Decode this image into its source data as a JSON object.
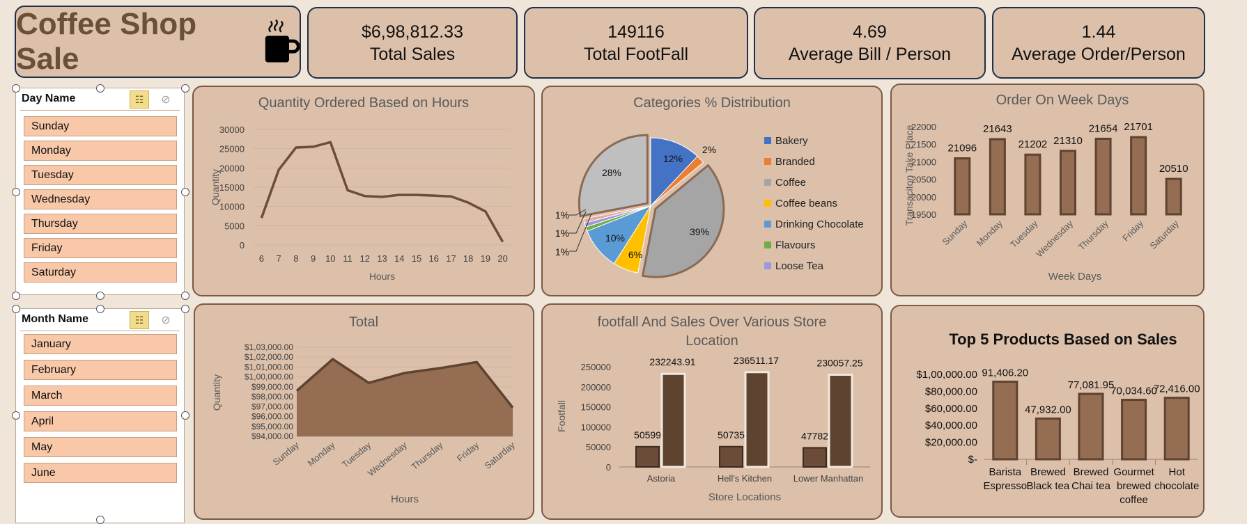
{
  "header": {
    "title": "Coffee Shop Sale"
  },
  "kpis": [
    {
      "value": "$6,98,812.33",
      "label": "Total Sales"
    },
    {
      "value": "149116",
      "label": "Total FootFall"
    },
    {
      "value": "4.69",
      "label": "Average Bill / Person"
    },
    {
      "value": "1.44",
      "label": "Average Order/Person"
    }
  ],
  "slicers": {
    "day": {
      "title": "Day Name",
      "items": [
        "Sunday",
        "Monday",
        "Tuesday",
        "Wednesday",
        "Thursday",
        "Friday",
        "Saturday"
      ]
    },
    "month": {
      "title": "Month Name",
      "items": [
        "January",
        "February",
        "March",
        "April",
        "May",
        "June"
      ]
    }
  },
  "colors": {
    "brown": "#946d52",
    "dark": "#5e4331",
    "line": "#6b4e3a",
    "panel": "#dcc0aa",
    "bakery": "#4472c4",
    "branded": "#ed7d31",
    "coffee": "#a5a5a5",
    "coffee_beans": "#ffc000",
    "drinking_chocolate": "#5b9bd5",
    "flavours": "#70ad47",
    "loose_tea": "#9999dd"
  },
  "chart_data": [
    {
      "type": "line",
      "title": "Quantity Ordered Based on Hours",
      "xlabel": "Hours",
      "ylabel": "Quantity",
      "x": [
        6,
        7,
        8,
        9,
        10,
        11,
        12,
        13,
        14,
        15,
        16,
        17,
        18,
        19,
        20
      ],
      "values": [
        7000,
        19500,
        25300,
        25500,
        26700,
        14200,
        12700,
        12500,
        13000,
        13000,
        12800,
        12600,
        11000,
        8700,
        800
      ],
      "ylim": [
        0,
        30000
      ],
      "yticks": [
        "0",
        "5000",
        "10000",
        "15000",
        "20000",
        "25000",
        "30000"
      ],
      "grid": true
    },
    {
      "type": "pie",
      "title": "Categories % Distribution",
      "slices": [
        {
          "name": "Bakery",
          "value": 12,
          "label": "12%"
        },
        {
          "name": "Branded",
          "value": 2,
          "label": "2%"
        },
        {
          "name": "Coffee",
          "value": 39,
          "label": "39%"
        },
        {
          "name": "Coffee beans",
          "value": 6,
          "label": "6%"
        },
        {
          "name": "Drinking Chocolate",
          "value": 10,
          "label": "10%"
        },
        {
          "name": "Flavours",
          "value": 1,
          "label": "1%"
        },
        {
          "name": "Loose Tea",
          "value": 1,
          "label": "1%"
        },
        {
          "name": "",
          "value": 1,
          "label": "1%"
        },
        {
          "name": "",
          "value": 28,
          "label": "28%"
        }
      ],
      "legend": "right"
    },
    {
      "type": "bar",
      "title": "Order On Week Days",
      "xlabel": "Week Days",
      "ylabel": "Transaciton Take Place",
      "categories": [
        "Sunday",
        "Monday",
        "Tuesday",
        "Wednesday",
        "Thursday",
        "Friday",
        "Saturday"
      ],
      "values": [
        21096,
        21643,
        21202,
        21310,
        21654,
        21701,
        20510
      ],
      "ylim": [
        19500,
        22000
      ],
      "yticks": [
        "19500",
        "20000",
        "20500",
        "21000",
        "21500",
        "22000"
      ]
    },
    {
      "type": "area",
      "title": "Total",
      "xlabel": "Hours",
      "ylabel": "Quantity",
      "categories": [
        "Sunday",
        "Monday",
        "Tuesday",
        "Wednesday",
        "Thursday",
        "Friday",
        "Saturday"
      ],
      "values": [
        98600,
        101800,
        99400,
        100400,
        100900,
        101500,
        96900
      ],
      "ylim": [
        94000,
        103000
      ],
      "yticks": [
        "$94,000.00",
        "$95,000.00",
        "$96,000.00",
        "$97,000.00",
        "$98,000.00",
        "$99,000.00",
        "$1,00,000.00",
        "$1,01,000.00",
        "$1,02,000.00",
        "$1,03,000.00"
      ],
      "grid": true
    },
    {
      "type": "bar",
      "title": "footfall And Sales Over Various Store Location",
      "xlabel": "Store Locations",
      "ylabel": "Footfall",
      "categories": [
        "Astoria",
        "Hell's Kitchen",
        "Lower Manhattan"
      ],
      "series": [
        {
          "values": [
            50599,
            50735,
            47782
          ],
          "labels": [
            "50599",
            "50735",
            "47782"
          ]
        },
        {
          "values": [
            232243.91,
            236511.17,
            230057.25
          ],
          "labels": [
            "232243.91",
            "236511.17",
            "230057.25"
          ]
        }
      ],
      "ylim": [
        0,
        250000
      ],
      "yticks": [
        "0",
        "50000",
        "100000",
        "150000",
        "200000",
        "250000"
      ]
    },
    {
      "type": "bar",
      "title": "Top 5 Products Based on Sales",
      "categories": [
        [
          "Barista",
          "Espresso"
        ],
        [
          "Brewed",
          "Black tea"
        ],
        [
          "Brewed",
          "Chai tea"
        ],
        [
          "Gourmet",
          "brewed",
          "coffee"
        ],
        [
          "Hot",
          "chocolate"
        ]
      ],
      "values": [
        91406.2,
        47932.0,
        77081.95,
        70034.6,
        72416.0
      ],
      "labels": [
        "91,406.20",
        "47,932.00",
        "77,081.95",
        "70,034.60",
        "72,416.00"
      ],
      "ylim": [
        0,
        100000
      ],
      "yticks": [
        "$-",
        "$20,000.00",
        "$40,000.00",
        "$60,000.00",
        "$80,000.00",
        "$1,00,000.00"
      ]
    }
  ]
}
